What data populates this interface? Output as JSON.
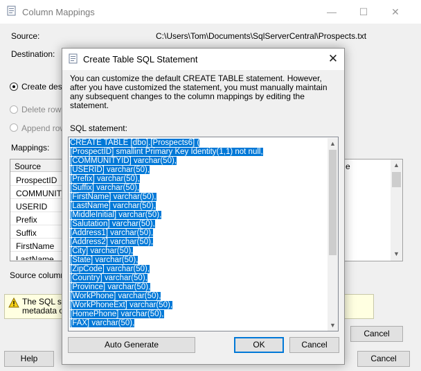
{
  "background_window": {
    "title": "Column Mappings",
    "source_label": "Source:",
    "source_value": "C:\\Users\\Tom\\Documents\\SqlServerCentral\\Prospects.txt",
    "destination_label": "Destination:",
    "options": {
      "create_label": "Create dest",
      "delete_label": "Delete rows",
      "append_label": "Append row"
    },
    "mappings_label": "Mappings:",
    "grid_header": "Source",
    "grid_header_right": "e",
    "grid_rows": [
      "ProspectID",
      "COMMUNITYI",
      "USERID",
      "Prefix",
      "Suffix",
      "FirstName",
      "LastName"
    ],
    "source_column_label": "Source column:",
    "warning_line1": "The SQL st",
    "warning_line2": "metadata of",
    "cancel_label": "Cancel",
    "help_label": "Help",
    "cancel_bottom_label": "Cancel"
  },
  "dialog": {
    "title": "Create Table SQL Statement",
    "close_glyph": "✕",
    "description": "You can customize the default CREATE TABLE statement. However, after you have customized the statement, you must manually maintain any subsequent changes to the column mappings by editing the statement.",
    "sql_label": "SQL statement:",
    "sql_lines": [
      "CREATE TABLE [dbo].[Prospects6] (",
      "[ProspectID] smallint Primary Key Identity(1,1) not null,",
      "[COMMUNITYID] varchar(50),",
      "[USERID] varchar(50),",
      "[Prefix] varchar(50),",
      "[Suffix] varchar(50),",
      "[FirstName] varchar(50),",
      "[LastName] varchar(50),",
      "[MiddleInitial] varchar(50),",
      "[Salutation] varchar(50),",
      "[Address1] varchar(50),",
      "[Address2] varchar(50),",
      "[City] varchar(50),",
      "[State] varchar(50),",
      "[ZipCode] varchar(50),",
      "[Country] varchar(50),",
      "[Province] varchar(50),",
      "[WorkPhone] varchar(50),",
      "[WorkPhoneExt] varchar(50),",
      "[HomePhone] varchar(50),",
      "[FAX] varchar(50),"
    ],
    "auto_generate_label": "Auto Generate",
    "ok_label": "OK",
    "cancel_label": "Cancel"
  },
  "colors": {
    "selection": "#0078d7",
    "warning_bg": "#ffffe1",
    "default_button_border": "#0078d7"
  }
}
